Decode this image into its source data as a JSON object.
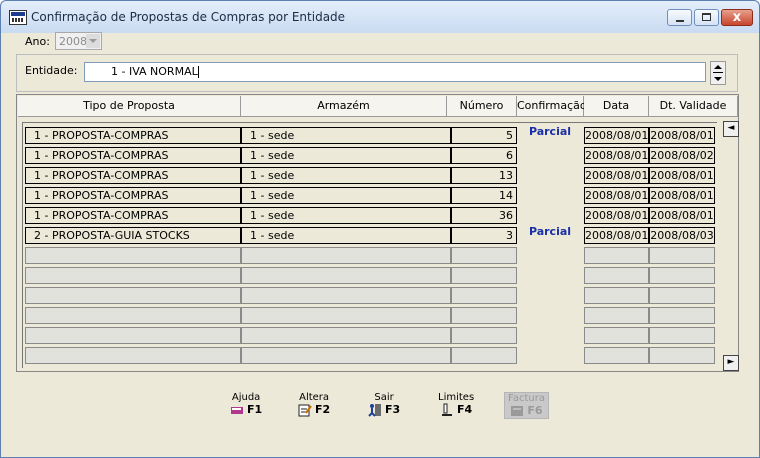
{
  "window": {
    "title": "Confirmação de Propostas de Compras por Entidade",
    "close_label": "x"
  },
  "ano": {
    "label": "Ano:",
    "value": "2008"
  },
  "entidade": {
    "label": "Entidade:",
    "value": "1 - IVA NORMAL"
  },
  "columns": [
    "Tipo de Proposta",
    "Armazém",
    "Número",
    "Confirmação",
    "Data",
    "Dt. Validade"
  ],
  "rows": [
    {
      "tipo": "1 - PROPOSTA-COMPRAS",
      "armazem": "1 - sede",
      "numero": "5",
      "confirmacao": "Parcial",
      "data": "2008/08/01",
      "validade": "2008/08/01"
    },
    {
      "tipo": "1 - PROPOSTA-COMPRAS",
      "armazem": "1 - sede",
      "numero": "6",
      "confirmacao": "",
      "data": "2008/08/01",
      "validade": "2008/08/02"
    },
    {
      "tipo": "1 - PROPOSTA-COMPRAS",
      "armazem": "1 - sede",
      "numero": "13",
      "confirmacao": "",
      "data": "2008/08/01",
      "validade": "2008/08/01"
    },
    {
      "tipo": "1 - PROPOSTA-COMPRAS",
      "armazem": "1 - sede",
      "numero": "14",
      "confirmacao": "",
      "data": "2008/08/01",
      "validade": "2008/08/01"
    },
    {
      "tipo": "1 - PROPOSTA-COMPRAS",
      "armazem": "1 - sede",
      "numero": "36",
      "confirmacao": "",
      "data": "2008/08/01",
      "validade": "2008/08/01"
    },
    {
      "tipo": "2 - PROPOSTA-GUIA STOCKS",
      "armazem": "1 - sede",
      "numero": "3",
      "confirmacao": "Parcial",
      "data": "2008/08/01",
      "validade": "2008/08/03"
    }
  ],
  "nav": {
    "prev": "◄",
    "next": "►"
  },
  "function_keys": [
    {
      "label": "Ajuda",
      "key": "F1",
      "icon": "book-icon"
    },
    {
      "label": "Altera",
      "key": "F2",
      "icon": "edit-icon"
    },
    {
      "label": "Sair",
      "key": "F3",
      "icon": "exit-icon"
    },
    {
      "label": "Limites",
      "key": "F4",
      "icon": "limits-icon"
    },
    {
      "label": "Factura",
      "key": "F6",
      "icon": "invoice-icon",
      "disabled": true
    }
  ]
}
